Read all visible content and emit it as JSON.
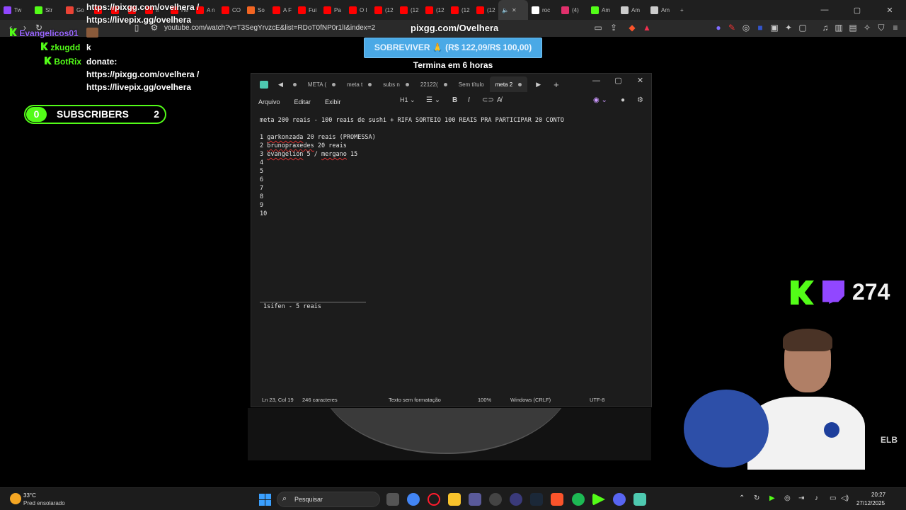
{
  "browser": {
    "tabs": [
      {
        "label": "Tw",
        "color": "#9147ff"
      },
      {
        "label": "Str",
        "color": "#53fc18"
      },
      {
        "label": "Go",
        "color": "#ea4335"
      },
      {
        "label": "",
        "color": "#ff0000"
      },
      {
        "label": "",
        "color": "#ff0000"
      },
      {
        "label": "",
        "color": "#ff0000"
      },
      {
        "label": "Ir",
        "color": "#ff0000"
      },
      {
        "label": "He",
        "color": "#ff0000"
      },
      {
        "label": "A n",
        "color": "#ff0000"
      },
      {
        "label": "CO",
        "color": "#ff0000"
      },
      {
        "label": "So",
        "color": "#f26522"
      },
      {
        "label": "A F",
        "color": "#ff0000"
      },
      {
        "label": "Fui",
        "color": "#ff0000"
      },
      {
        "label": "Pa",
        "color": "#ff0000"
      },
      {
        "label": "O I",
        "color": "#ff0000"
      },
      {
        "label": "(12",
        "color": "#ff0000"
      },
      {
        "label": "(12",
        "color": "#ff0000"
      },
      {
        "label": "(12",
        "color": "#ff0000"
      },
      {
        "label": "(12",
        "color": "#ff0000"
      },
      {
        "label": "(12",
        "color": "#ff0000"
      }
    ],
    "extra_tabs": [
      {
        "label": "roc",
        "color": "#ffffff"
      },
      {
        "label": "(4)",
        "color": "#e1306c"
      },
      {
        "label": "Am",
        "color": "#53fc18"
      },
      {
        "label": "Am",
        "color": "#cccccc"
      },
      {
        "label": "Am",
        "color": "#cccccc"
      }
    ],
    "new_tab": "+",
    "url": "youtube.com/watch?v=T3SegYrvzcE&list=RDoT0fNP0r1lI&index=2",
    "window_controls": [
      "—",
      "▢",
      "✕"
    ]
  },
  "chat": {
    "lines": [
      {
        "user": "",
        "text": "https://pixgg.com/ovelhera /"
      },
      {
        "user": "",
        "text": "https://livepix.gg/ovelhera"
      },
      {
        "user": "Evangelicos01",
        "text": ""
      },
      {
        "user": "zkugdd",
        "text": "k"
      },
      {
        "user": "BotRix",
        "text": "donate:"
      },
      {
        "user": "",
        "text": "https://pixgg.com/ovelhera /"
      },
      {
        "user": "",
        "text": "https://livepix.gg/ovelhera"
      }
    ]
  },
  "subscribers": {
    "current": "0",
    "label": "SUBSCRIBERS",
    "goal": "2"
  },
  "goal": {
    "title": "pixgg.com/Ovelhera",
    "banner": "SOBREVIVER 🙏 (R$ 122,09/R$ 100,00)",
    "timer": "Termina em 6 horas"
  },
  "notepad": {
    "tabs": [
      "META (",
      "meta t",
      "subs n",
      "22122(",
      "Sem título",
      "meta 2"
    ],
    "menu": [
      "Arquivo",
      "Editar",
      "Exibir"
    ],
    "heading_selector": "H1",
    "header_line": "meta 200 reais - 100 reais de sushi + RIFA SORTEIO 100 REAIS PRA PARTICIPAR 20 CONTO",
    "entries": [
      {
        "num": "1",
        "name": "garkonzada",
        "rest": " 20 reais (PROMESSA)"
      },
      {
        "num": "2",
        "name": "brunopraxedes",
        "rest": " 20 reais"
      },
      {
        "num": "3",
        "name": "evangelion",
        "rest": " 5 / ",
        "name2": "mergano",
        "rest2": " 15"
      },
      {
        "num": "4"
      },
      {
        "num": "5"
      },
      {
        "num": "6"
      },
      {
        "num": "7"
      },
      {
        "num": "8"
      },
      {
        "num": "9"
      },
      {
        "num": "10"
      }
    ],
    "footnote": "1sifen - 5 reais",
    "status": {
      "position": "Ln 23, Col 19",
      "chars": "246 caracteres",
      "format": "Texto sem formatação",
      "zoom": "100%",
      "eol": "Windows (CRLF)",
      "encoding": "UTF-8"
    }
  },
  "viewers": {
    "count": "274"
  },
  "webcam_label": "ELB",
  "taskbar": {
    "weather_temp": "33°C",
    "weather_desc": "Pred ensolarado",
    "search_placeholder": "Pesquisar",
    "time": "20:27",
    "date": "27/12/2025"
  }
}
